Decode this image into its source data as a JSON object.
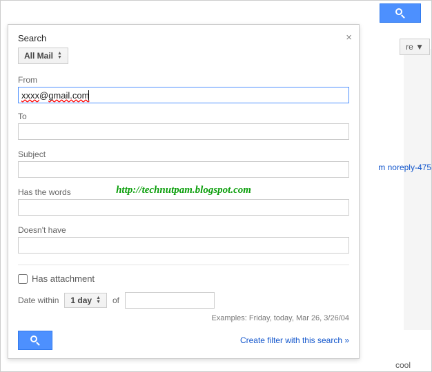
{
  "topbar": {
    "search_button": "search"
  },
  "bg": {
    "more_label": "re",
    "link_text": "m noreply-475",
    "cool": "cool"
  },
  "panel": {
    "title": "Search",
    "scope_selected": "All Mail",
    "fields": {
      "from_label": "From",
      "from_value": "xxxx@gmail.com",
      "to_label": "To",
      "to_value": "",
      "subject_label": "Subject",
      "subject_value": "",
      "haswords_label": "Has the words",
      "haswords_value": "",
      "doesnthave_label": "Doesn't have",
      "doesnthave_value": ""
    },
    "attachment_label": "Has attachment",
    "date": {
      "within_label": "Date within",
      "range_selected": "1 day",
      "of_label": "of",
      "date_value": ""
    },
    "examples": "Examples: Friday, today, Mar 26, 3/26/04",
    "create_filter": "Create filter with this search »"
  },
  "watermark": "http://technutpam.blogspot.com"
}
